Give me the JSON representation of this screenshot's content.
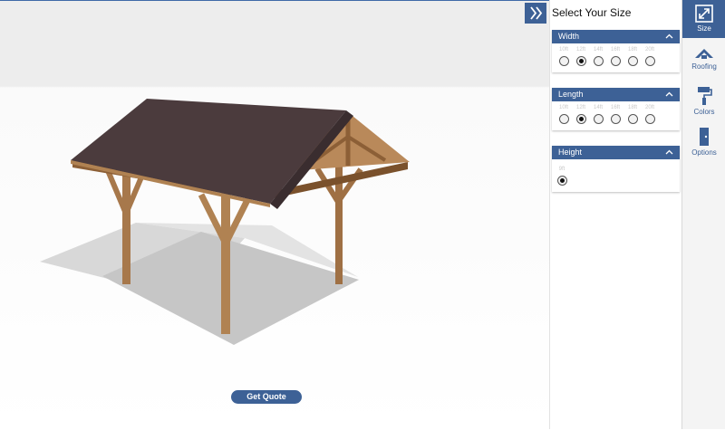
{
  "viewer": {
    "get_quote_label": "Get Quote"
  },
  "panel": {
    "title": "Select Your Size",
    "toggle_icon": "chevron-double-right-icon",
    "sections": [
      {
        "title": "Width",
        "options": [
          "10ft",
          "12ft",
          "14ft",
          "16ft",
          "18ft",
          "20ft"
        ],
        "selected": "12ft"
      },
      {
        "title": "Length",
        "options": [
          "10ft",
          "12ft",
          "14ft",
          "16ft",
          "18ft",
          "20ft"
        ],
        "selected": "12ft"
      },
      {
        "title": "Height",
        "options": [
          "9ft"
        ],
        "selected": "9ft"
      }
    ]
  },
  "rail": {
    "items": [
      {
        "label": "Size",
        "icon": "resize-icon",
        "active": true
      },
      {
        "label": "Roofing",
        "icon": "roof-icon",
        "active": false
      },
      {
        "label": "Colors",
        "icon": "paint-roller-icon",
        "active": false
      },
      {
        "label": "Options",
        "icon": "door-icon",
        "active": false
      }
    ]
  },
  "colors": {
    "accent": "#3d6196",
    "shingle": "#4a3a3c",
    "wood": "#a87a4c"
  }
}
